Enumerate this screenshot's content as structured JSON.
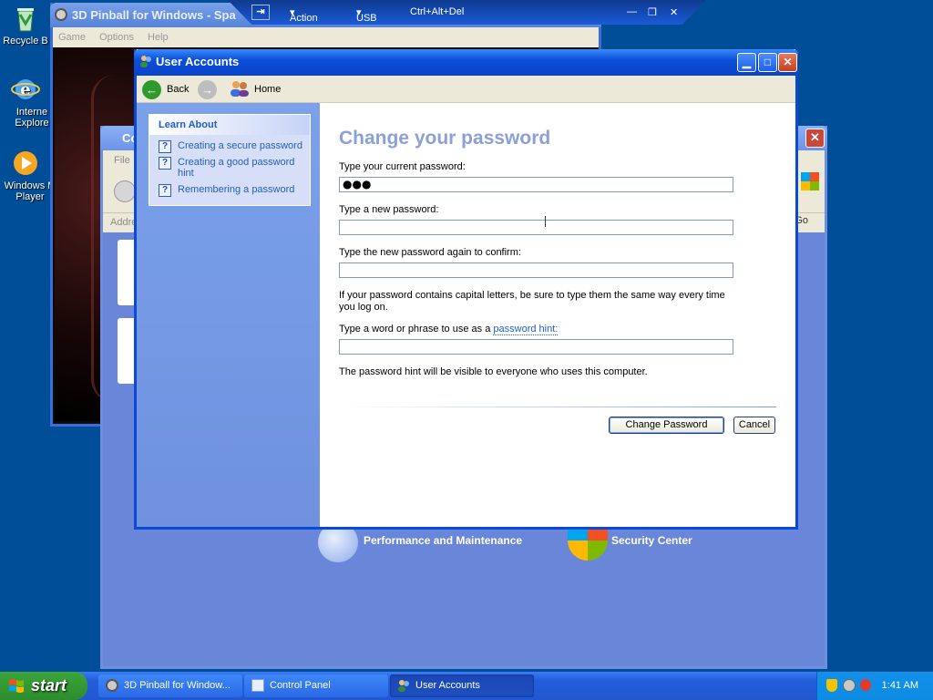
{
  "desktop": {
    "icons": [
      {
        "label": "Recycle B",
        "icon": "recycle-bin-icon"
      },
      {
        "label": "Interne Explore",
        "icon": "internet-explorer-icon"
      },
      {
        "label": "Windows M Player",
        "icon": "windows-media-player-icon"
      }
    ]
  },
  "pinball": {
    "title": "3D Pinball for Windows - Spa",
    "menu": [
      "Game",
      "Options",
      "Help"
    ]
  },
  "remote_toolbar": {
    "items": [
      "Action",
      "USB",
      "Ctrl+Alt+Del"
    ]
  },
  "control_panel": {
    "title": "Co",
    "menu_fragment": "File",
    "address_label": "Addre",
    "go_label": "Go",
    "categories": [
      {
        "label": "Performance and Maintenance",
        "icon": "performance-icon"
      },
      {
        "label": "Security Center",
        "icon": "shield-icon"
      }
    ]
  },
  "user_accounts": {
    "title": "User Accounts",
    "nav": {
      "back": "Back",
      "home": "Home"
    },
    "learn_about": {
      "heading": "Learn About",
      "items": [
        "Creating a secure password",
        "Creating a good password hint",
        "Remembering a password"
      ]
    },
    "heading": "Change your password",
    "current_password_label": "Type your current password:",
    "current_password_value": "●●●",
    "new_password_label": "Type a new password:",
    "new_password_value": "",
    "confirm_password_label": "Type the new password again to confirm:",
    "confirm_password_value": "",
    "caps_note": "If your password contains capital letters, be sure to type them the same way every time you log on.",
    "hint_label_prefix": "Type a word or phrase to use as a",
    "hint_link": "password hint:",
    "hint_value": "",
    "hint_note": "The password hint will be visible to everyone who uses this computer.",
    "buttons": {
      "change": "Change Password",
      "cancel": "Cancel"
    }
  },
  "taskbar": {
    "start": "start",
    "tasks": [
      {
        "label": "3D Pinball for Window...",
        "icon": "pinball-icon",
        "active": false
      },
      {
        "label": "Control Panel",
        "icon": "control-panel-icon",
        "active": false
      },
      {
        "label": "User Accounts",
        "icon": "user-accounts-icon",
        "active": true
      }
    ],
    "clock": "1:41 AM"
  },
  "colors": {
    "desktop": "#004e98",
    "titlebar": "#0a49d3",
    "link": "#215dc6",
    "heading": "#8aa0d6"
  }
}
